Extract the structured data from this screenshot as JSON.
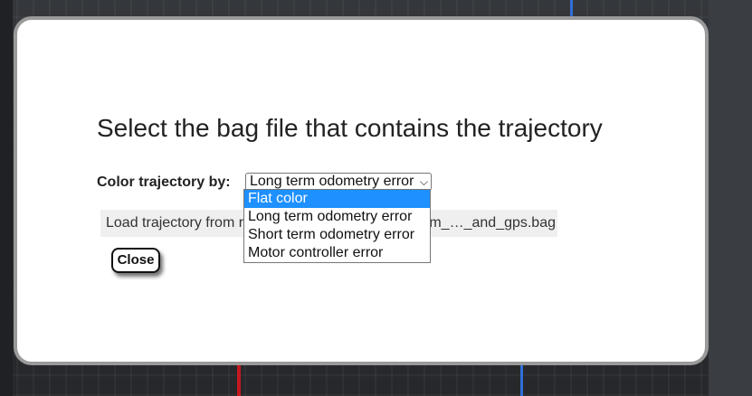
{
  "dialog": {
    "title": "Select the bag file that contains the trajectory",
    "color_label": "Color trajectory by:",
    "select_value": "Long term odometry error",
    "load_label": "Load trajectory from r",
    "load_file": "m_…_and_gps.bag",
    "close_label": "Close"
  },
  "dropdown": {
    "options": [
      {
        "label": "Flat color",
        "highlighted": true
      },
      {
        "label": "Long term odometry error",
        "highlighted": false
      },
      {
        "label": "Short term odometry error",
        "highlighted": false
      },
      {
        "label": "Motor controller error",
        "highlighted": false
      }
    ],
    "highlight_color": "#1e90ff"
  },
  "background": {
    "track_colors": [
      "#2f6fd8",
      "#c3191e"
    ]
  }
}
